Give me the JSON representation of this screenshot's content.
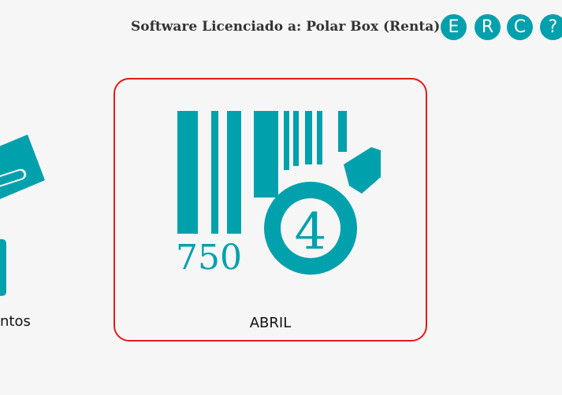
{
  "header": {
    "license_text": "Software Licenciado a: Polar Box (Renta)",
    "buttons": {
      "e": "E",
      "r": "R",
      "c": "C",
      "help": "?"
    }
  },
  "tiles": {
    "left": {
      "label": "ntos"
    },
    "abril": {
      "label": "ABRIL",
      "icon_number": "750",
      "icon_digit": "4"
    }
  },
  "colors": {
    "accent": "#00a0ad",
    "selected_border": "#e01b1b",
    "background": "#f6f6f6"
  }
}
